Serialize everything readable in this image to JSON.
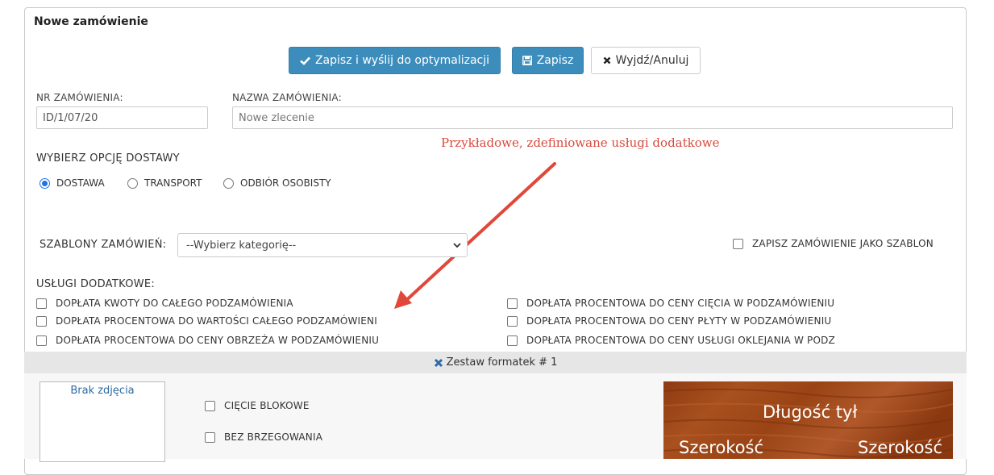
{
  "panel": {
    "title": "Nowe zamówienie"
  },
  "toolbar": {
    "save_send_label": "Zapisz i wyślij do optymalizacji",
    "save_label": "Zapisz",
    "cancel_label": "Wyjdź/Anuluj"
  },
  "order": {
    "number_label": "NR ZAMÓWIENIA:",
    "number_value": "ID/1/07/20",
    "name_label": "NAZWA ZAMÓWIENIA:",
    "name_placeholder": "Nowe zlecenie"
  },
  "delivery": {
    "label": "WYBIERZ OPCJĘ DOSTAWY",
    "options": [
      {
        "label": "DOSTAWA",
        "checked": true
      },
      {
        "label": "TRANSPORT",
        "checked": false
      },
      {
        "label": "ODBIÓR OSOBISTY",
        "checked": false
      }
    ]
  },
  "annotation": "Przykładowe, zdefiniowane usługi dodatkowe",
  "templates": {
    "label": "SZABLONY ZAMÓWIEŃ:",
    "selected": "--Wybierz kategorię--",
    "save_as_template_label": "ZAPISZ ZAMÓWIENIE JAKO SZABLON"
  },
  "extras": {
    "label": "USŁUGI DODATKOWE:",
    "left": [
      "DOPŁATA KWOTY DO CAŁEGO PODZAMÓWIENIA",
      "DOPŁATA PROCENTOWA DO WARTOŚCI CAŁEGO PODZAMÓWIENI",
      "DOPŁATA PROCENTOWA DO CENY OBRZEŻA W PODZAMÓWIENIU"
    ],
    "right": [
      "DOPŁATA PROCENTOWA DO CENY CIĘCIA W PODZAMÓWIENIU",
      "DOPŁATA PROCENTOWA DO CENY PŁYTY W PODZAMÓWIENIU",
      "DOPŁATA PROCENTOWA DO CENY USŁUGI OKLEJANIA W PODZ"
    ]
  },
  "set": {
    "title": "Zestaw formatek # 1",
    "no_photo": "Brak zdjęcia",
    "options": [
      "CIĘCIE BLOKOWE",
      "BEZ BRZEGOWANIA"
    ],
    "preview": {
      "length_back": "Długość tył",
      "width_left": "Szerokość",
      "width_right": "Szerokość"
    }
  },
  "colors": {
    "primary": "#3c8dbc",
    "annotation": "#d84a3c",
    "link": "#2d6aa3"
  }
}
